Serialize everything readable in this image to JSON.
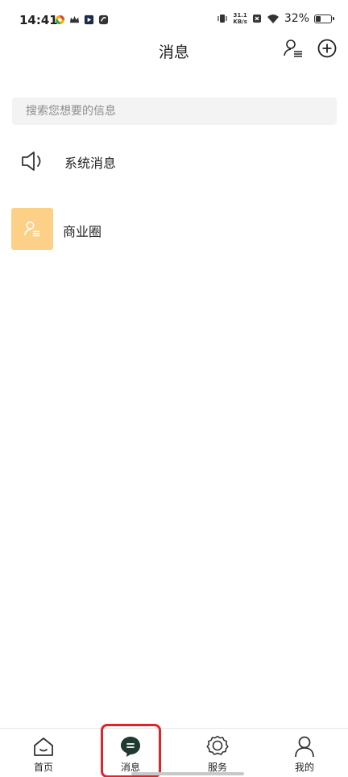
{
  "status_bar": {
    "time": "14:41",
    "net_speed_value": "31.1",
    "net_speed_unit": "KB/s",
    "battery_percent": "32%",
    "battery_level": 0.32
  },
  "header": {
    "title": "消息"
  },
  "search": {
    "placeholder": "搜索您想要的信息"
  },
  "list": {
    "items": [
      {
        "label": "系统消息",
        "icon": "speaker-icon"
      },
      {
        "label": "商业圈",
        "icon": "contacts-icon"
      }
    ]
  },
  "bottom_nav": {
    "items": [
      {
        "label": "首页",
        "icon": "home-icon"
      },
      {
        "label": "消息",
        "icon": "message-icon",
        "active": true
      },
      {
        "label": "服务",
        "icon": "service-badge-icon"
      },
      {
        "label": "我的",
        "icon": "profile-icon"
      }
    ]
  },
  "colors": {
    "accent": "#1f3a30",
    "avatar_bg": "#fdd088",
    "highlight": "#e0242b"
  }
}
